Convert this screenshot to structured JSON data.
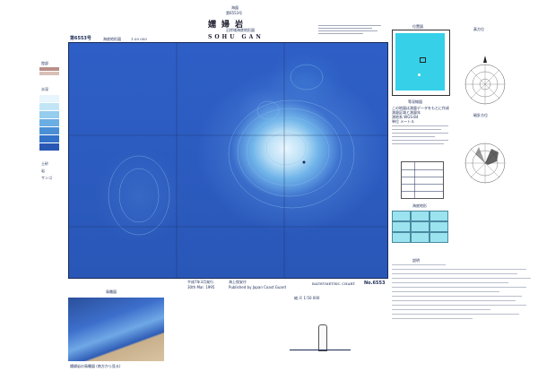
{
  "header": {
    "top_small": "海図",
    "top_small2": "第6553号",
    "title_jp": "嬬婦岩",
    "title_en": "SOHU GAN",
    "subtitle": "沿岸域海底地形図"
  },
  "map_meta": {
    "chart_number_left": "第6553号",
    "area_label": "海底地形図",
    "scale_label": "1:50 000",
    "chart_title_en": "BATHYMETRIC CHART",
    "chart_number_right": "No.6553",
    "publisher_jp": "海上保安庁",
    "publisher_en": "Published by Japan Coast Guard",
    "edition_date": "平成7年3月発行",
    "edition_en": "30th Mar. 1995",
    "bottom_scale_label": "縮 尺 1:50 000"
  },
  "legend": {
    "title": "陸部",
    "depth_title": "水深",
    "colors": [
      "#e8f5fc",
      "#c2e5f6",
      "#94cdee",
      "#6aaee3",
      "#4a8fd6",
      "#3272c9",
      "#2857b4"
    ],
    "land_colors": [
      "#b98f88",
      "#d8c0b6"
    ],
    "items": [
      "土砂",
      "岩",
      "サンゴ"
    ]
  },
  "inset": {
    "title": "位置図",
    "sea_color": "#36d0e8"
  },
  "right_panel": {
    "title1": "等深線図",
    "title2": "海底地形",
    "title3": "説明",
    "notes": [
      "この地図は測量データをもとに作成",
      "測量区域と測量年",
      "測地系 WGS-84",
      "単位 メートル"
    ]
  },
  "compass": {
    "title1": "真方位",
    "title2": "磁針方位"
  },
  "panel_3d": {
    "title": "鳥瞰図",
    "caption": "嬬婦岩の鳥瞰図 (南方から見る)"
  }
}
